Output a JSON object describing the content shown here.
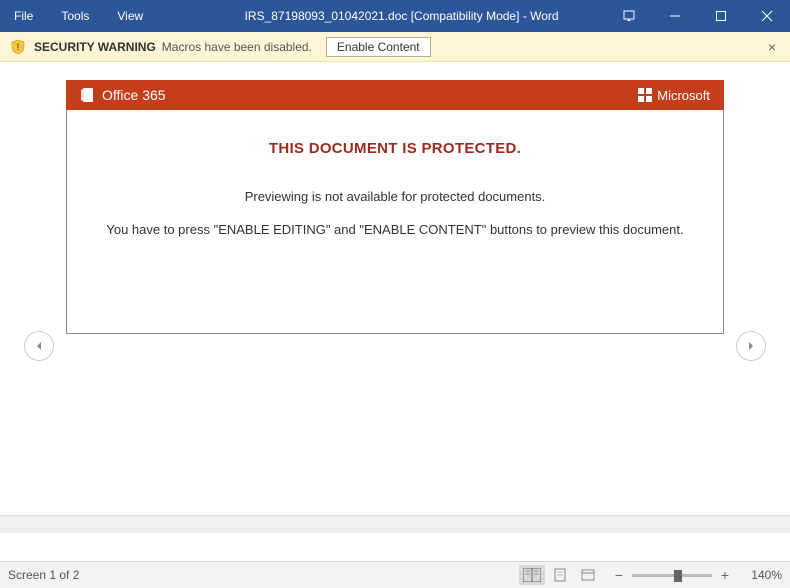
{
  "titlebar": {
    "menu": {
      "file": "File",
      "tools": "Tools",
      "view": "View"
    },
    "title": "IRS_87198093_01042021.doc [Compatibility Mode] - Word"
  },
  "security": {
    "label": "SECURITY WARNING",
    "message": "Macros have been disabled.",
    "enable_label": "Enable Content"
  },
  "doc": {
    "o365_label": "Office 365",
    "ms_label": "Microsoft",
    "headline": "THIS DOCUMENT IS PROTECTED.",
    "line1": "Previewing is not available for protected documents.",
    "line2": "You have to press \"ENABLE EDITING\" and \"ENABLE CONTENT\" buttons to preview this document."
  },
  "status": {
    "screen_label": "Screen 1 of 2",
    "zoom_minus": "−",
    "zoom_plus": "+",
    "zoom_value": "140%"
  }
}
